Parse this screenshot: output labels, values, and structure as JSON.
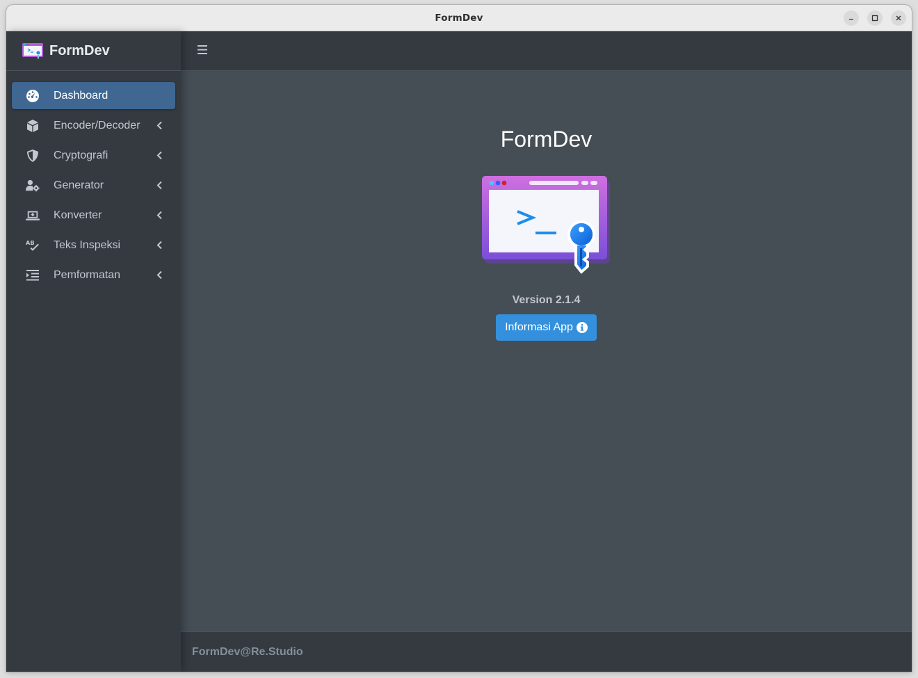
{
  "window": {
    "title": "FormDev"
  },
  "brand": {
    "name": "FormDev"
  },
  "sidebar": {
    "items": [
      {
        "label": "Dashboard",
        "icon": "gauge-icon",
        "active": true
      },
      {
        "label": "Encoder/Decoder",
        "icon": "cube-icon",
        "active": false
      },
      {
        "label": "Cryptografi",
        "icon": "shield-icon",
        "active": false
      },
      {
        "label": "Generator",
        "icon": "user-gear-icon",
        "active": false
      },
      {
        "label": "Konverter",
        "icon": "laptop-plus-icon",
        "active": false
      },
      {
        "label": "Teks Inspeksi",
        "icon": "spell-check-icon",
        "active": false
      },
      {
        "label": "Pemformatan",
        "icon": "indent-icon",
        "active": false
      }
    ]
  },
  "main": {
    "title": "FormDev",
    "version": "Version 2.1.4",
    "info_button": "Informasi App"
  },
  "footer": {
    "text": "FormDev@Re.Studio"
  },
  "colors": {
    "sidebar_bg": "#343a40",
    "content_bg": "#454d55",
    "active_item": "#3f6791",
    "button": "#3490dc",
    "text_muted": "#c2c7d0"
  }
}
